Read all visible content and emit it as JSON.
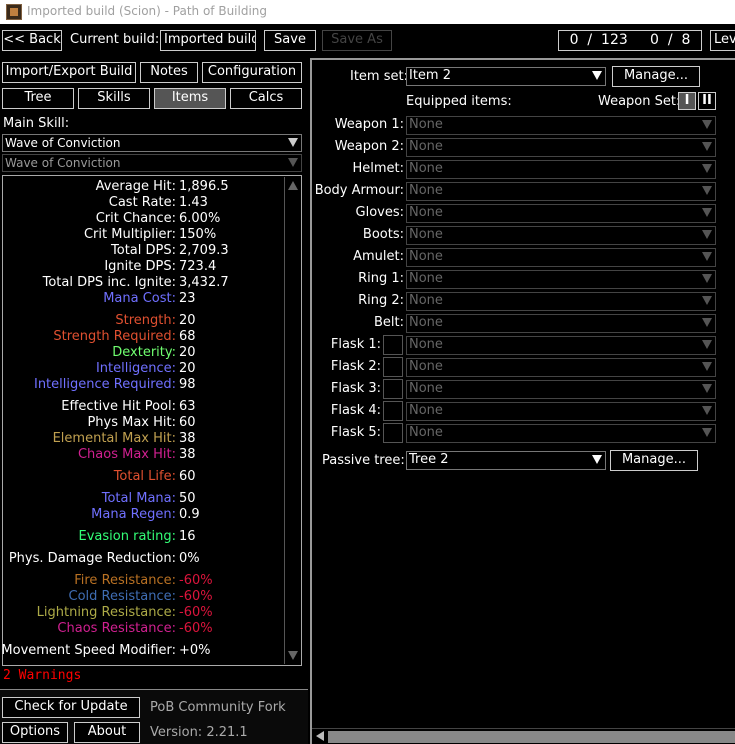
{
  "window": {
    "title": "Imported build (Scion) - Path of Building"
  },
  "topbar": {
    "back": "<< Back",
    "current_build_label": "Current build:",
    "build_name": "Imported build",
    "save": "Save",
    "save_as": "Save As",
    "points": "0  /  123     0  /  8",
    "level_partial": "Lev"
  },
  "nav": {
    "import_export": "Import/Export Build",
    "notes": "Notes",
    "configuration": "Configuration",
    "tree": "Tree",
    "skills": "Skills",
    "items": "Items",
    "calcs": "Calcs"
  },
  "main_skill": {
    "label": "Main Skill:",
    "skill": "Wave of Conviction",
    "sub_skill": "Wave of Conviction"
  },
  "colors": {
    "white": "#ffffff",
    "mana": "#7070ff",
    "strength": "#e05030",
    "dexterity": "#70ff70",
    "intelligence": "#7070ff",
    "elemental": "#c0a050",
    "chaos": "#d02090",
    "life": "#e05030",
    "evasion": "#33ff77",
    "fire": "#b97123",
    "cold": "#3f6db3",
    "lightning": "#adaa47",
    "negative": "#dc143c",
    "warning": "#ff0000"
  },
  "stats": [
    {
      "label": "Average Hit:",
      "value": "1,896.5",
      "color": "#ffffff",
      "vcolor": "#ffffff"
    },
    {
      "label": "Cast Rate:",
      "value": "1.43",
      "color": "#ffffff",
      "vcolor": "#ffffff"
    },
    {
      "label": "Crit Chance:",
      "value": "6.00%",
      "color": "#ffffff",
      "vcolor": "#ffffff"
    },
    {
      "label": "Crit Multiplier:",
      "value": "150%",
      "color": "#ffffff",
      "vcolor": "#ffffff"
    },
    {
      "label": "Total DPS:",
      "value": "2,709.3",
      "color": "#ffffff",
      "vcolor": "#ffffff"
    },
    {
      "label": "Ignite DPS:",
      "value": "723.4",
      "color": "#ffffff",
      "vcolor": "#ffffff"
    },
    {
      "label": "Total DPS inc. Ignite:",
      "value": "3,432.7",
      "color": "#ffffff",
      "vcolor": "#ffffff"
    },
    {
      "label": "Mana Cost:",
      "value": "23",
      "color": "#7070ff",
      "vcolor": "#ffffff"
    },
    {
      "label": "Strength:",
      "value": "20",
      "color": "#e05030",
      "vcolor": "#ffffff"
    },
    {
      "label": "Strength Required:",
      "value": "68",
      "color": "#e05030",
      "vcolor": "#ffffff"
    },
    {
      "label": "Dexterity:",
      "value": "20",
      "color": "#70ff70",
      "vcolor": "#ffffff"
    },
    {
      "label": "Intelligence:",
      "value": "20",
      "color": "#7070ff",
      "vcolor": "#ffffff"
    },
    {
      "label": "Intelligence Required:",
      "value": "98",
      "color": "#7070ff",
      "vcolor": "#ffffff"
    },
    {
      "label": "Effective Hit Pool:",
      "value": "63",
      "color": "#ffffff",
      "vcolor": "#ffffff"
    },
    {
      "label": "Phys Max Hit:",
      "value": "60",
      "color": "#ffffff",
      "vcolor": "#ffffff"
    },
    {
      "label": "Elemental Max Hit:",
      "value": "38",
      "color": "#c0a050",
      "vcolor": "#ffffff"
    },
    {
      "label": "Chaos Max Hit:",
      "value": "38",
      "color": "#d02090",
      "vcolor": "#ffffff"
    },
    {
      "label": "Total Life:",
      "value": "60",
      "color": "#e05030",
      "vcolor": "#ffffff"
    },
    {
      "label": "Total Mana:",
      "value": "50",
      "color": "#7070ff",
      "vcolor": "#ffffff"
    },
    {
      "label": "Mana Regen:",
      "value": "0.9",
      "color": "#7070ff",
      "vcolor": "#ffffff"
    },
    {
      "label": "Evasion rating:",
      "value": "16",
      "color": "#33ff77",
      "vcolor": "#ffffff"
    },
    {
      "label": "Phys. Damage Reduction:",
      "value": "0%",
      "color": "#ffffff",
      "vcolor": "#ffffff"
    },
    {
      "label": "Fire Resistance:",
      "value": "-60%",
      "color": "#b97123",
      "vcolor": "#dc143c"
    },
    {
      "label": "Cold Resistance:",
      "value": "-60%",
      "color": "#3f6db3",
      "vcolor": "#dc143c"
    },
    {
      "label": "Lightning Resistance:",
      "value": "-60%",
      "color": "#adaa47",
      "vcolor": "#dc143c"
    },
    {
      "label": "Chaos Resistance:",
      "value": "-60%",
      "color": "#d02090",
      "vcolor": "#dc143c"
    },
    {
      "label": "Movement Speed Modifier:",
      "value": "+0%",
      "color": "#ffffff",
      "vcolor": "#ffffff"
    }
  ],
  "warnings": "2 Warnings",
  "bottom": {
    "check_update": "Check for Update",
    "fork": "PoB Community Fork",
    "options": "Options",
    "about": "About",
    "version": "Version: 2.21.1"
  },
  "items_panel": {
    "item_set_label": "Item set:",
    "item_set": "Item 2",
    "manage": "Manage...",
    "equipped_label": "Equipped items:",
    "weapon_set_label": "Weapon Set:",
    "weapon_set_1": "I",
    "weapon_set_2": "II",
    "slots": [
      {
        "label": "Weapon 1:",
        "value": "None"
      },
      {
        "label": "Weapon 2:",
        "value": "None"
      },
      {
        "label": "Helmet:",
        "value": "None"
      },
      {
        "label": "Body Armour:",
        "value": "None"
      },
      {
        "label": "Gloves:",
        "value": "None"
      },
      {
        "label": "Boots:",
        "value": "None"
      },
      {
        "label": "Amulet:",
        "value": "None"
      },
      {
        "label": "Ring 1:",
        "value": "None"
      },
      {
        "label": "Ring 2:",
        "value": "None"
      },
      {
        "label": "Belt:",
        "value": "None"
      },
      {
        "label": "Flask 1:",
        "value": "None"
      },
      {
        "label": "Flask 2:",
        "value": "None"
      },
      {
        "label": "Flask 3:",
        "value": "None"
      },
      {
        "label": "Flask 4:",
        "value": "None"
      },
      {
        "label": "Flask 5:",
        "value": "None"
      }
    ],
    "passive_tree_label": "Passive tree:",
    "passive_tree": "Tree 2",
    "manage_tree": "Manage..."
  }
}
